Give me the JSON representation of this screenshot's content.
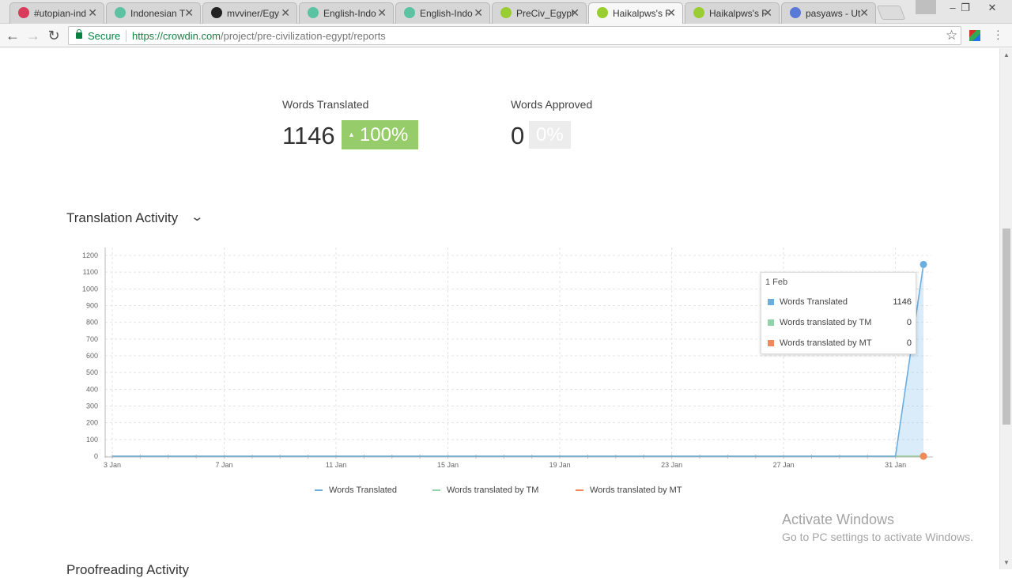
{
  "browser": {
    "tabs": [
      {
        "title": "#utopian-ind",
        "icon_color": "#d93b5a",
        "active": false
      },
      {
        "title": "Indonesian T",
        "icon_color": "#5bc2a2",
        "active": false
      },
      {
        "title": "mvviner/Egy",
        "icon_color": "#222222",
        "active": false
      },
      {
        "title": "English-Indo",
        "icon_color": "#5bc2a2",
        "active": false
      },
      {
        "title": "English-Indo",
        "icon_color": "#5bc2a2",
        "active": false
      },
      {
        "title": "PreCiv_Egypt",
        "icon_color": "#9acd32",
        "active": false
      },
      {
        "title": "Haikalpws's F",
        "icon_color": "#9acd32",
        "active": true
      },
      {
        "title": "Haikalpws's F",
        "icon_color": "#9acd32",
        "active": false
      },
      {
        "title": "pasyaws - Ut",
        "icon_color": "#5a78d6",
        "active": false
      }
    ],
    "window_controls": {
      "minimize": "–",
      "restore": "❐",
      "close": "✕"
    },
    "nav": {
      "back": "←",
      "forward": "→",
      "reload": "↻"
    },
    "address": {
      "secure_label": "Secure",
      "scheme": "https://",
      "host": "crowdin.com",
      "path": "/project/pre-civilization-egypt/reports"
    },
    "icons": {
      "bookmark": "star-icon",
      "extension": "extension-icon",
      "menu": "kebab-menu-icon"
    }
  },
  "stats": {
    "words_translated": {
      "label": "Words Translated",
      "value": "1146",
      "change": "100%"
    },
    "words_approved": {
      "label": "Words Approved",
      "value": "0",
      "change": "0%"
    }
  },
  "section": {
    "title": "Translation Activity",
    "next_title": "Proofreading Activity"
  },
  "tooltip": {
    "date": "1 Feb",
    "rows": [
      {
        "name": "Words Translated",
        "value": "1146",
        "color": "#6aaee0"
      },
      {
        "name": "Words translated by TM",
        "value": "0",
        "color": "#90d3a8"
      },
      {
        "name": "Words translated by MT",
        "value": "0",
        "color": "#f0885a"
      }
    ]
  },
  "legend": [
    {
      "name": "Words Translated",
      "color": "#6aaee0"
    },
    {
      "name": "Words translated by TM",
      "color": "#90d3a8"
    },
    {
      "name": "Words translated by MT",
      "color": "#f0885a"
    }
  ],
  "watermark": {
    "title": "Activate Windows",
    "subtitle": "Go to PC settings to activate Windows."
  },
  "chart_data": {
    "type": "line",
    "title": "",
    "xlabel": "",
    "ylabel": "",
    "ylim": [
      0,
      1200
    ],
    "yticks": [
      0,
      100,
      200,
      300,
      400,
      500,
      600,
      700,
      800,
      900,
      1000,
      1100,
      1200
    ],
    "xticks": [
      "3 Jan",
      "7 Jan",
      "11 Jan",
      "15 Jan",
      "19 Jan",
      "23 Jan",
      "27 Jan",
      "31 Jan"
    ],
    "x": [
      "3 Jan",
      "4 Jan",
      "5 Jan",
      "6 Jan",
      "7 Jan",
      "8 Jan",
      "9 Jan",
      "10 Jan",
      "11 Jan",
      "12 Jan",
      "13 Jan",
      "14 Jan",
      "15 Jan",
      "16 Jan",
      "17 Jan",
      "18 Jan",
      "19 Jan",
      "20 Jan",
      "21 Jan",
      "22 Jan",
      "23 Jan",
      "24 Jan",
      "25 Jan",
      "26 Jan",
      "27 Jan",
      "28 Jan",
      "29 Jan",
      "30 Jan",
      "31 Jan",
      "1 Feb"
    ],
    "series": [
      {
        "name": "Words Translated",
        "color": "#6aaee0",
        "values": [
          0,
          0,
          0,
          0,
          0,
          0,
          0,
          0,
          0,
          0,
          0,
          0,
          0,
          0,
          0,
          0,
          0,
          0,
          0,
          0,
          0,
          0,
          0,
          0,
          0,
          0,
          0,
          0,
          0,
          1146
        ]
      },
      {
        "name": "Words translated by TM",
        "color": "#90d3a8",
        "values": [
          0,
          0,
          0,
          0,
          0,
          0,
          0,
          0,
          0,
          0,
          0,
          0,
          0,
          0,
          0,
          0,
          0,
          0,
          0,
          0,
          0,
          0,
          0,
          0,
          0,
          0,
          0,
          0,
          0,
          0
        ]
      },
      {
        "name": "Words translated by MT",
        "color": "#f0885a",
        "values": [
          0,
          0,
          0,
          0,
          0,
          0,
          0,
          0,
          0,
          0,
          0,
          0,
          0,
          0,
          0,
          0,
          0,
          0,
          0,
          0,
          0,
          0,
          0,
          0,
          0,
          0,
          0,
          0,
          0,
          0
        ]
      }
    ],
    "grid": true,
    "legend_position": "bottom"
  }
}
